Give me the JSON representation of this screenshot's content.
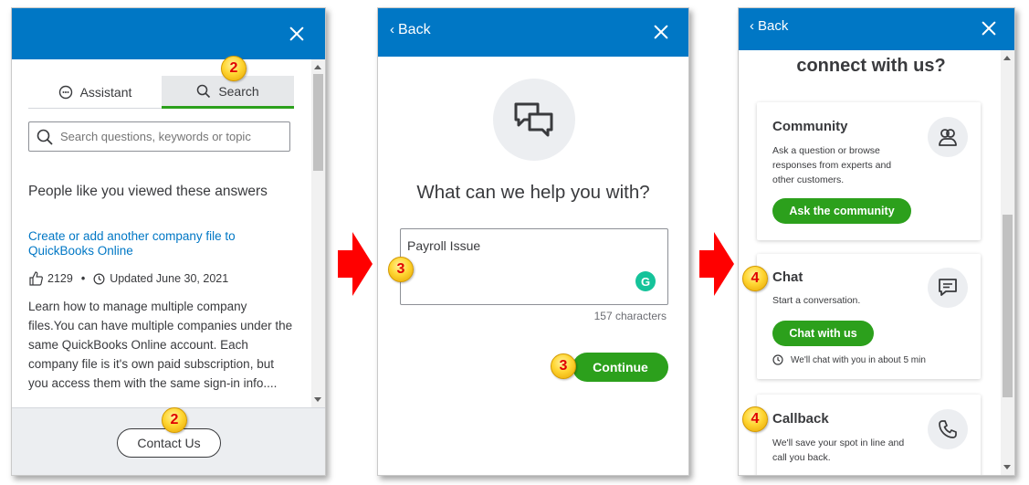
{
  "panel1": {
    "tabs": [
      {
        "label": "Assistant",
        "icon": "chat-bubble-icon"
      },
      {
        "label": "Search",
        "icon": "search-icon"
      }
    ],
    "search_placeholder": "Search questions, keywords or topic",
    "heading": "People like you viewed these answers",
    "article": {
      "title": "Create or add another company file to QuickBooks Online",
      "likes": "2129",
      "updated": "Updated June 30, 2021",
      "description": "Learn how to manage multiple company files.You can have multiple companies under the same QuickBooks Online account. Each company file is it's own paid subscription, but you access them with the same sign-in info...."
    },
    "contact_button": "Contact Us",
    "badges": [
      "2",
      "2"
    ]
  },
  "panel2": {
    "back_label": "Back",
    "title": "What can we help you with?",
    "textarea_value": "Payroll Issue",
    "grammarly_glyph": "G",
    "char_count": "157 characters",
    "continue_button": "Continue",
    "badges": [
      "3",
      "3"
    ]
  },
  "panel3": {
    "back_label": "Back",
    "title": "connect with us?",
    "cards": [
      {
        "title": "Community",
        "description": "Ask a question or browse responses from experts and other customers.",
        "button": "Ask the community",
        "icon": "community-icon"
      },
      {
        "title": "Chat",
        "description": "Start a conversation.",
        "button": "Chat with us",
        "wait": "We'll chat with you in about 5 min",
        "icon": "chat-icon"
      },
      {
        "title": "Callback",
        "description": "We'll save your spot in line and call you back.",
        "icon": "phone-icon"
      }
    ],
    "badges": [
      "4",
      "4"
    ]
  },
  "colors": {
    "header": "#0077c5",
    "accent_green": "#2ca01c",
    "link": "#0077c5",
    "arrow": "#ff0000"
  }
}
